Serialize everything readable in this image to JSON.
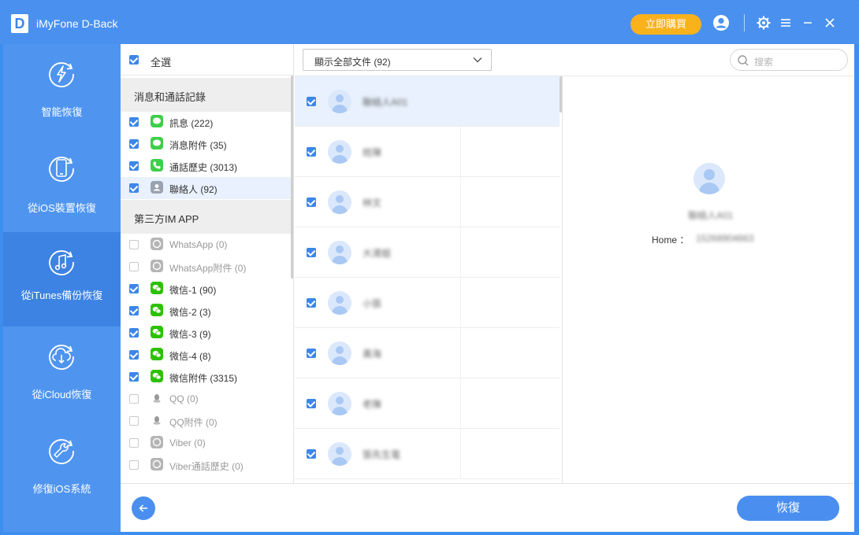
{
  "app": {
    "logo_letter": "D",
    "title": "iMyFone D-Back"
  },
  "titlebar": {
    "buy_label": "立即購買",
    "icons": [
      "user-icon",
      "gear-icon",
      "menu-icon",
      "minimize-icon",
      "close-icon"
    ]
  },
  "nav": {
    "items": [
      {
        "label": "智能恢復",
        "icon": "lightning-refresh-icon",
        "active": false
      },
      {
        "label": "從iOS裝置恢復",
        "icon": "phone-refresh-icon",
        "active": false
      },
      {
        "label": "從iTunes備份恢復",
        "icon": "music-refresh-icon",
        "active": true
      },
      {
        "label": "從iCloud恢復",
        "icon": "cloud-download-icon",
        "active": false
      },
      {
        "label": "修復iOS系統",
        "icon": "wrench-icon",
        "active": false
      }
    ]
  },
  "categories": {
    "select_all": "全選",
    "groups": [
      {
        "header": "消息和通話記錄",
        "items": [
          {
            "label": "訊息 (222)",
            "checked": true,
            "icon": "messages-icon",
            "color": "#3ecf4a"
          },
          {
            "label": "消息附件 (35)",
            "checked": true,
            "icon": "messages-icon",
            "color": "#3ecf4a"
          },
          {
            "label": "通話歷史 (3013)",
            "checked": true,
            "icon": "phone-icon",
            "color": "#3ecf4a"
          },
          {
            "label": "聯絡人 (92)",
            "checked": true,
            "icon": "contacts-icon",
            "color": "#9aa4b0",
            "selected": true
          }
        ]
      },
      {
        "header": "第三方IM APP",
        "items": [
          {
            "label": "WhatsApp (0)",
            "checked": false,
            "icon": "whatsapp-icon",
            "color": "#b5b5b5"
          },
          {
            "label": "WhatsApp附件 (0)",
            "checked": false,
            "icon": "whatsapp-icon",
            "color": "#b5b5b5"
          },
          {
            "label": "微信-1 (90)",
            "checked": true,
            "icon": "wechat-icon",
            "color": "#2dc100"
          },
          {
            "label": "微信-2 (3)",
            "checked": true,
            "icon": "wechat-icon",
            "color": "#2dc100"
          },
          {
            "label": "微信-3 (9)",
            "checked": true,
            "icon": "wechat-icon",
            "color": "#2dc100"
          },
          {
            "label": "微信-4 (8)",
            "checked": true,
            "icon": "wechat-icon",
            "color": "#2dc100"
          },
          {
            "label": "微信附件 (3315)",
            "checked": true,
            "icon": "wechat-icon",
            "color": "#2dc100"
          },
          {
            "label": "QQ (0)",
            "checked": false,
            "icon": "qq-icon",
            "color": "#b5b5b5"
          },
          {
            "label": "QQ附件 (0)",
            "checked": false,
            "icon": "qq-icon",
            "color": "#b5b5b5"
          },
          {
            "label": "Viber (0)",
            "checked": false,
            "icon": "viber-icon",
            "color": "#b5b5b5"
          },
          {
            "label": "Viber通話歷史 (0)",
            "checked": false,
            "icon": "viber-icon",
            "color": "#b5b5b5"
          }
        ]
      }
    ]
  },
  "toolbar": {
    "filter_label": "顯示全部文件 (92)",
    "search_placeholder": "搜索"
  },
  "contacts": [
    {
      "name": "聯絡人A01",
      "checked": true,
      "selected": true
    },
    {
      "name": "姓陳",
      "checked": true
    },
    {
      "name": "林文",
      "checked": true
    },
    {
      "name": "大清姐",
      "checked": true
    },
    {
      "name": "小張",
      "checked": true
    },
    {
      "name": "黃海",
      "checked": true
    },
    {
      "name": "老陳",
      "checked": true
    },
    {
      "name": "張先生電",
      "checked": true
    }
  ],
  "detail": {
    "name": "聯絡人A01",
    "phone_label": "Home ：",
    "phone_value": "15268904663"
  },
  "footer": {
    "back_icon": "arrow-left-icon",
    "recover_label": "恢復"
  },
  "colors": {
    "primary": "#4a8ff0",
    "nav_active": "#3d83e3",
    "buy": "#f9b21c",
    "selected_row": "#e8f1fd"
  }
}
